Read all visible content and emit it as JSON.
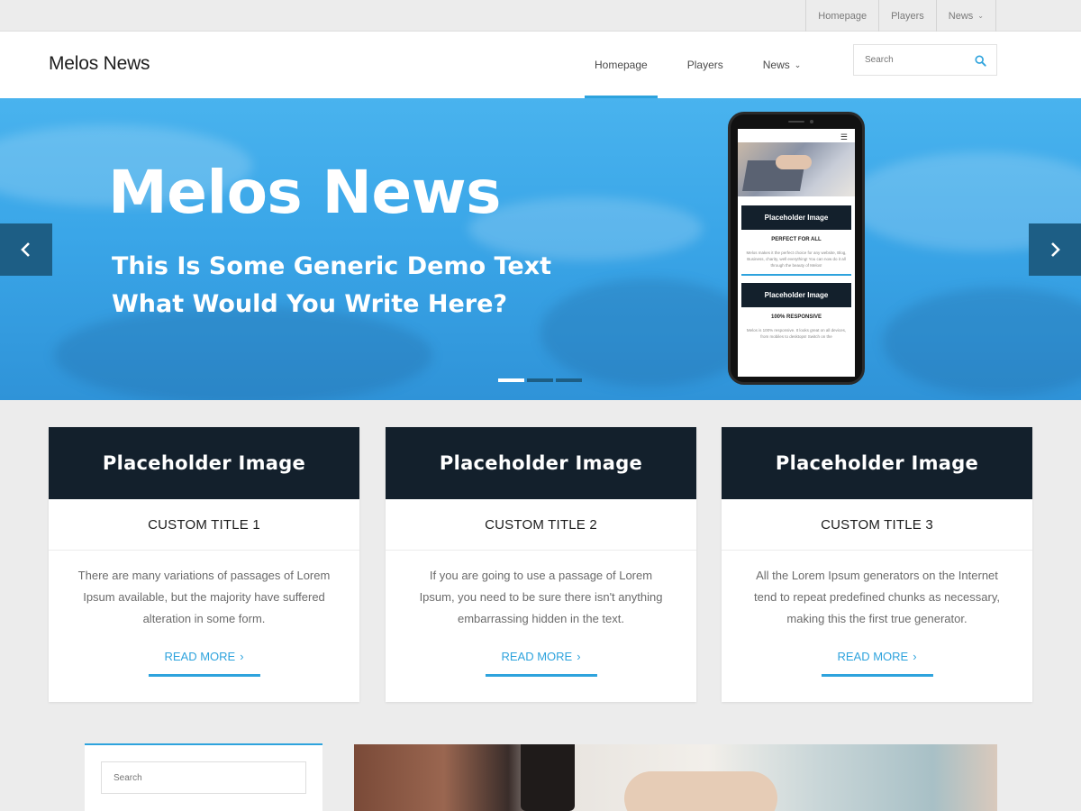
{
  "topbar": {
    "items": [
      {
        "label": "Homepage"
      },
      {
        "label": "Players"
      },
      {
        "label": "News"
      }
    ]
  },
  "header": {
    "logo": "Melos News",
    "nav": [
      {
        "label": "Homepage",
        "active": true
      },
      {
        "label": "Players",
        "active": false
      },
      {
        "label": "News",
        "active": false
      }
    ],
    "search": {
      "placeholder": "Search"
    }
  },
  "hero": {
    "title": "Melos News",
    "subtitle_line1": "This Is Some Generic Demo Text",
    "subtitle_line2": "What Would You Write Here?",
    "slide_count": 3,
    "active_slide": 1,
    "phone": {
      "card1_title": "Placeholder Image",
      "card1_heading": "PERFECT FOR ALL",
      "card1_text": "Melos makes it the perfect choice for any website, Blog, Business, charity, well everything! You can now do it all through the beauty of Melos!",
      "card2_title": "Placeholder Image",
      "card2_heading": "100% RESPONSIVE",
      "card2_text": "Melos is 100% responsive. It looks great on all devices, from mobiles to desktops! Switch on the"
    }
  },
  "cards": [
    {
      "image_label": "Placeholder Image",
      "title": "CUSTOM TITLE 1",
      "text": "There are many variations of passages of Lorem Ipsum available, but the majority have suffered alteration in some form.",
      "button": "READ MORE"
    },
    {
      "image_label": "Placeholder Image",
      "title": "CUSTOM TITLE 2",
      "text": "If you are going to use a passage of Lorem Ipsum, you need to be sure there isn't anything embarrassing hidden in the text.",
      "button": "READ MORE"
    },
    {
      "image_label": "Placeholder Image",
      "title": "CUSTOM TITLE 3",
      "text": "All the Lorem Ipsum generators on the Internet tend to repeat predefined chunks as necessary, making this the first true generator.",
      "button": "READ MORE"
    }
  ],
  "sidebar": {
    "search": {
      "placeholder": "Search"
    }
  },
  "colors": {
    "accent": "#2ea3dd",
    "dark_card": "#13202c",
    "slider_arrow": "#1d5e85",
    "page_bg": "#ececec"
  },
  "icons": {
    "search": "search-icon",
    "prev": "chevron-left-icon",
    "next": "chevron-right-icon",
    "dropdown": "chevron-down-icon",
    "menu": "hamburger-icon"
  }
}
